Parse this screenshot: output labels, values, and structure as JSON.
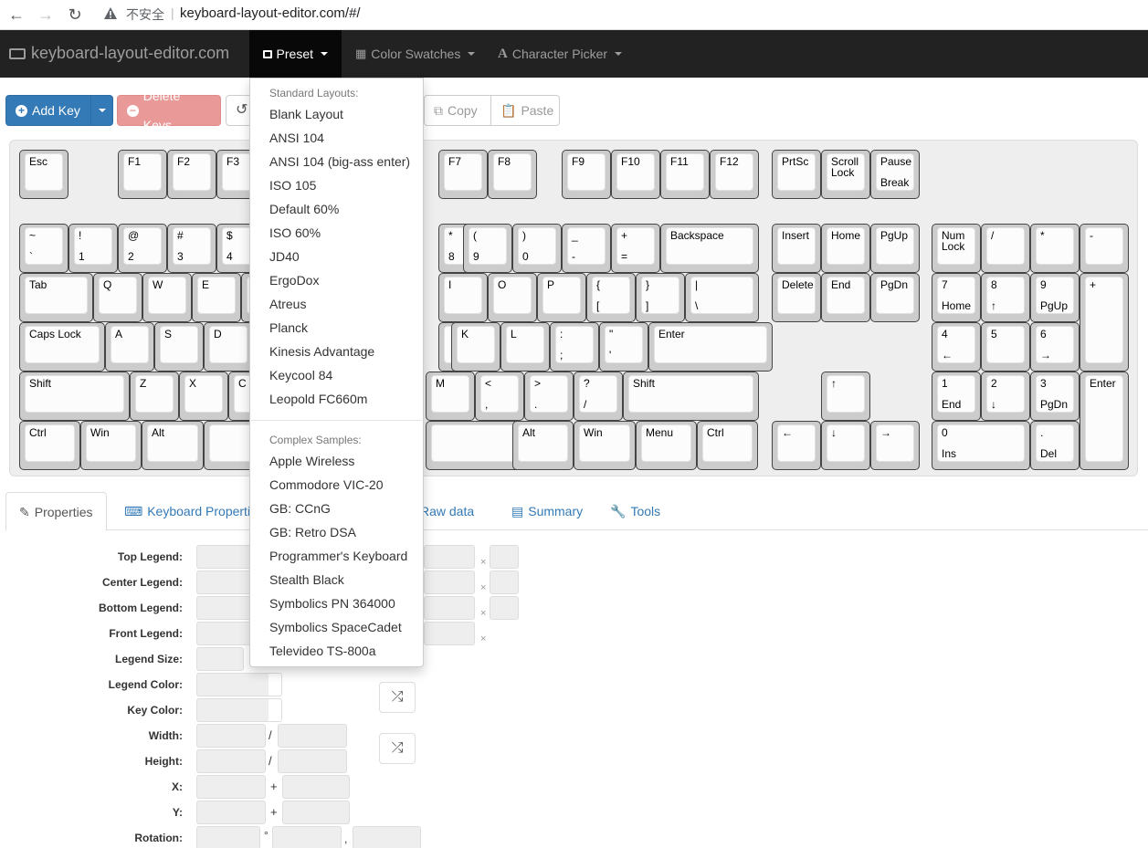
{
  "browser": {
    "insecure_label": "不安全",
    "separator": "|",
    "url": "keyboard-layout-editor.com/#/"
  },
  "navbar": {
    "brand": "keyboard-layout-editor.com",
    "preset": "Preset",
    "color_swatches": "Color Swatches",
    "character_picker": "Character Picker"
  },
  "toolbar": {
    "add_key": "Add Key",
    "delete_keys": "Delete Keys",
    "copy": "Copy",
    "paste": "Paste"
  },
  "keyboard": {
    "keys": [
      {
        "t": "Esc",
        "b": ""
      },
      {
        "t": "F1",
        "b": ""
      },
      {
        "t": "F2",
        "b": ""
      },
      {
        "t": "F3",
        "b": ""
      },
      {
        "t": "F7",
        "b": ""
      },
      {
        "t": "F8",
        "b": ""
      },
      {
        "t": "F9",
        "b": ""
      },
      {
        "t": "F10",
        "b": ""
      },
      {
        "t": "F11",
        "b": ""
      },
      {
        "t": "F12",
        "b": ""
      },
      {
        "t": "PrtSc",
        "b": ""
      },
      {
        "t": "Scroll\nLock",
        "b": ""
      },
      {
        "t": "Pause",
        "b": "Break"
      },
      {
        "t": "~",
        "b": "`"
      },
      {
        "t": "!",
        "b": "1"
      },
      {
        "t": "@",
        "b": "2"
      },
      {
        "t": "#",
        "b": "3"
      },
      {
        "t": "$",
        "b": "4"
      },
      {
        "t": "*",
        "b": "8"
      },
      {
        "t": "(",
        "b": "9"
      },
      {
        "t": ")",
        "b": "0"
      },
      {
        "t": "_",
        "b": "-"
      },
      {
        "t": "+",
        "b": "="
      },
      {
        "t": "Backspace",
        "b": ""
      },
      {
        "t": "Insert",
        "b": ""
      },
      {
        "t": "Home",
        "b": ""
      },
      {
        "t": "PgUp",
        "b": ""
      },
      {
        "t": "Num\nLock",
        "b": ""
      },
      {
        "t": "/",
        "b": ""
      },
      {
        "t": "*",
        "b": ""
      },
      {
        "t": "-",
        "b": ""
      },
      {
        "t": "Tab",
        "b": ""
      },
      {
        "t": "Q",
        "b": ""
      },
      {
        "t": "W",
        "b": ""
      },
      {
        "t": "E",
        "b": ""
      },
      {
        "t": "",
        "b": ""
      },
      {
        "t": "I",
        "b": ""
      },
      {
        "t": "O",
        "b": ""
      },
      {
        "t": "P",
        "b": ""
      },
      {
        "t": "{",
        "b": "["
      },
      {
        "t": "}",
        "b": "]"
      },
      {
        "t": "|",
        "b": "\\"
      },
      {
        "t": "Delete",
        "b": ""
      },
      {
        "t": "End",
        "b": ""
      },
      {
        "t": "PgDn",
        "b": ""
      },
      {
        "t": "7",
        "b": "Home"
      },
      {
        "t": "8",
        "b": "↑"
      },
      {
        "t": "9",
        "b": "PgUp"
      },
      {
        "t": "+",
        "b": ""
      },
      {
        "t": "Caps Lock",
        "b": ""
      },
      {
        "t": "A",
        "b": ""
      },
      {
        "t": "S",
        "b": ""
      },
      {
        "t": "D",
        "b": ""
      },
      {
        "t": "",
        "b": ""
      },
      {
        "t": "",
        "b": ""
      },
      {
        "t": "K",
        "b": ""
      },
      {
        "t": "L",
        "b": ""
      },
      {
        "t": ":",
        "b": ";"
      },
      {
        "t": "\"",
        "b": "'"
      },
      {
        "t": "Enter",
        "b": ""
      },
      {
        "t": "4",
        "b": "←"
      },
      {
        "t": "5",
        "b": ""
      },
      {
        "t": "6",
        "b": "→"
      },
      {
        "t": "Shift",
        "b": ""
      },
      {
        "t": "Z",
        "b": ""
      },
      {
        "t": "X",
        "b": ""
      },
      {
        "t": "C",
        "b": ""
      },
      {
        "t": "M",
        "b": ""
      },
      {
        "t": "<",
        "b": ","
      },
      {
        "t": ">",
        "b": "."
      },
      {
        "t": "?",
        "b": "/"
      },
      {
        "t": "Shift",
        "b": ""
      },
      {
        "t": "↑",
        "b": ""
      },
      {
        "t": "1",
        "b": "End"
      },
      {
        "t": "2",
        "b": "↓"
      },
      {
        "t": "3",
        "b": "PgDn"
      },
      {
        "t": "Enter",
        "b": ""
      },
      {
        "t": "Ctrl",
        "b": ""
      },
      {
        "t": "Win",
        "b": ""
      },
      {
        "t": "Alt",
        "b": ""
      },
      {
        "t": "",
        "b": ""
      },
      {
        "t": "",
        "b": ""
      },
      {
        "t": "Alt",
        "b": ""
      },
      {
        "t": "Win",
        "b": ""
      },
      {
        "t": "Menu",
        "b": ""
      },
      {
        "t": "Ctrl",
        "b": ""
      },
      {
        "t": "←",
        "b": ""
      },
      {
        "t": "↓",
        "b": ""
      },
      {
        "t": "→",
        "b": ""
      },
      {
        "t": "0",
        "b": "Ins"
      },
      {
        "t": ".",
        "b": "Del"
      }
    ]
  },
  "tabs": {
    "properties": "Properties",
    "keyboard_properties": "Keyboard Properties",
    "raw_data": "Raw data",
    "summary": "Summary",
    "tools": "Tools"
  },
  "form": {
    "top_legend": "Top Legend:",
    "center_legend": "Center Legend:",
    "bottom_legend": "Bottom Legend:",
    "front_legend": "Front Legend:",
    "legend_size": "Legend Size:",
    "legend_color": "Legend Color:",
    "key_color": "Key Color:",
    "width": "Width:",
    "height": "Height:",
    "x": "X:",
    "y": "Y:",
    "rotation": "Rotation:",
    "slash": "/",
    "plus": "+",
    "degree": "°",
    "comma": ",",
    "clear": "×"
  },
  "preset_menu": {
    "standard_header": "Standard Layouts:",
    "standard": [
      "Blank Layout",
      "ANSI 104",
      "ANSI 104 (big-ass enter)",
      "ISO 105",
      "Default 60%",
      "ISO 60%",
      "JD40",
      "ErgoDox",
      "Atreus",
      "Planck",
      "Kinesis Advantage",
      "Keycool 84",
      "Leopold FC660m"
    ],
    "complex_header": "Complex Samples:",
    "complex": [
      "Apple Wireless",
      "Commodore VIC-20",
      "GB: CCnG",
      "GB: Retro DSA",
      "Programmer's Keyboard",
      "Stealth Black",
      "Symbolics PN 364000",
      "Symbolics SpaceCadet",
      "Televideo TS-800a"
    ]
  }
}
